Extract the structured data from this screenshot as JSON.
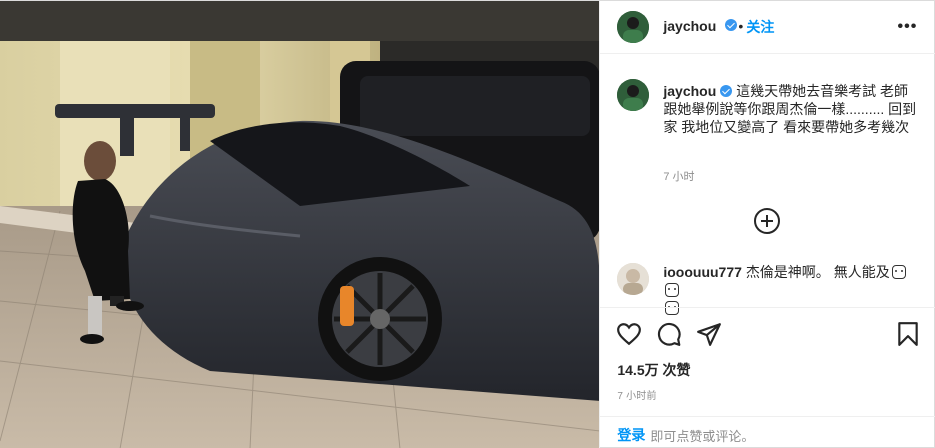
{
  "header": {
    "username": "jaychou",
    "separator": "•",
    "follow_label": "关注",
    "more_label": "•••"
  },
  "caption": {
    "username": "jaychou",
    "text": "這幾天帶她去音樂考試 老師跟她舉例說等你跟周杰倫一樣.......... 回到家 我地位又變高了 看來要帶她多考幾次",
    "time": "7 小时"
  },
  "comment": {
    "username": "iooouuu777",
    "text": "杰倫是神啊。 無人能及"
  },
  "actions": {
    "like_icon": "heart-icon",
    "comment_icon": "comment-icon",
    "share_icon": "paper-plane-icon",
    "save_icon": "bookmark-icon"
  },
  "stats": {
    "likes": "14.5万 次赞",
    "posted": "7 小时前"
  },
  "footer": {
    "login_label": "登录",
    "hint": "即可点赞或评论。"
  },
  "colors": {
    "accent": "#0095f6",
    "verified": "#3897f0",
    "muted": "#8e8e8e"
  }
}
